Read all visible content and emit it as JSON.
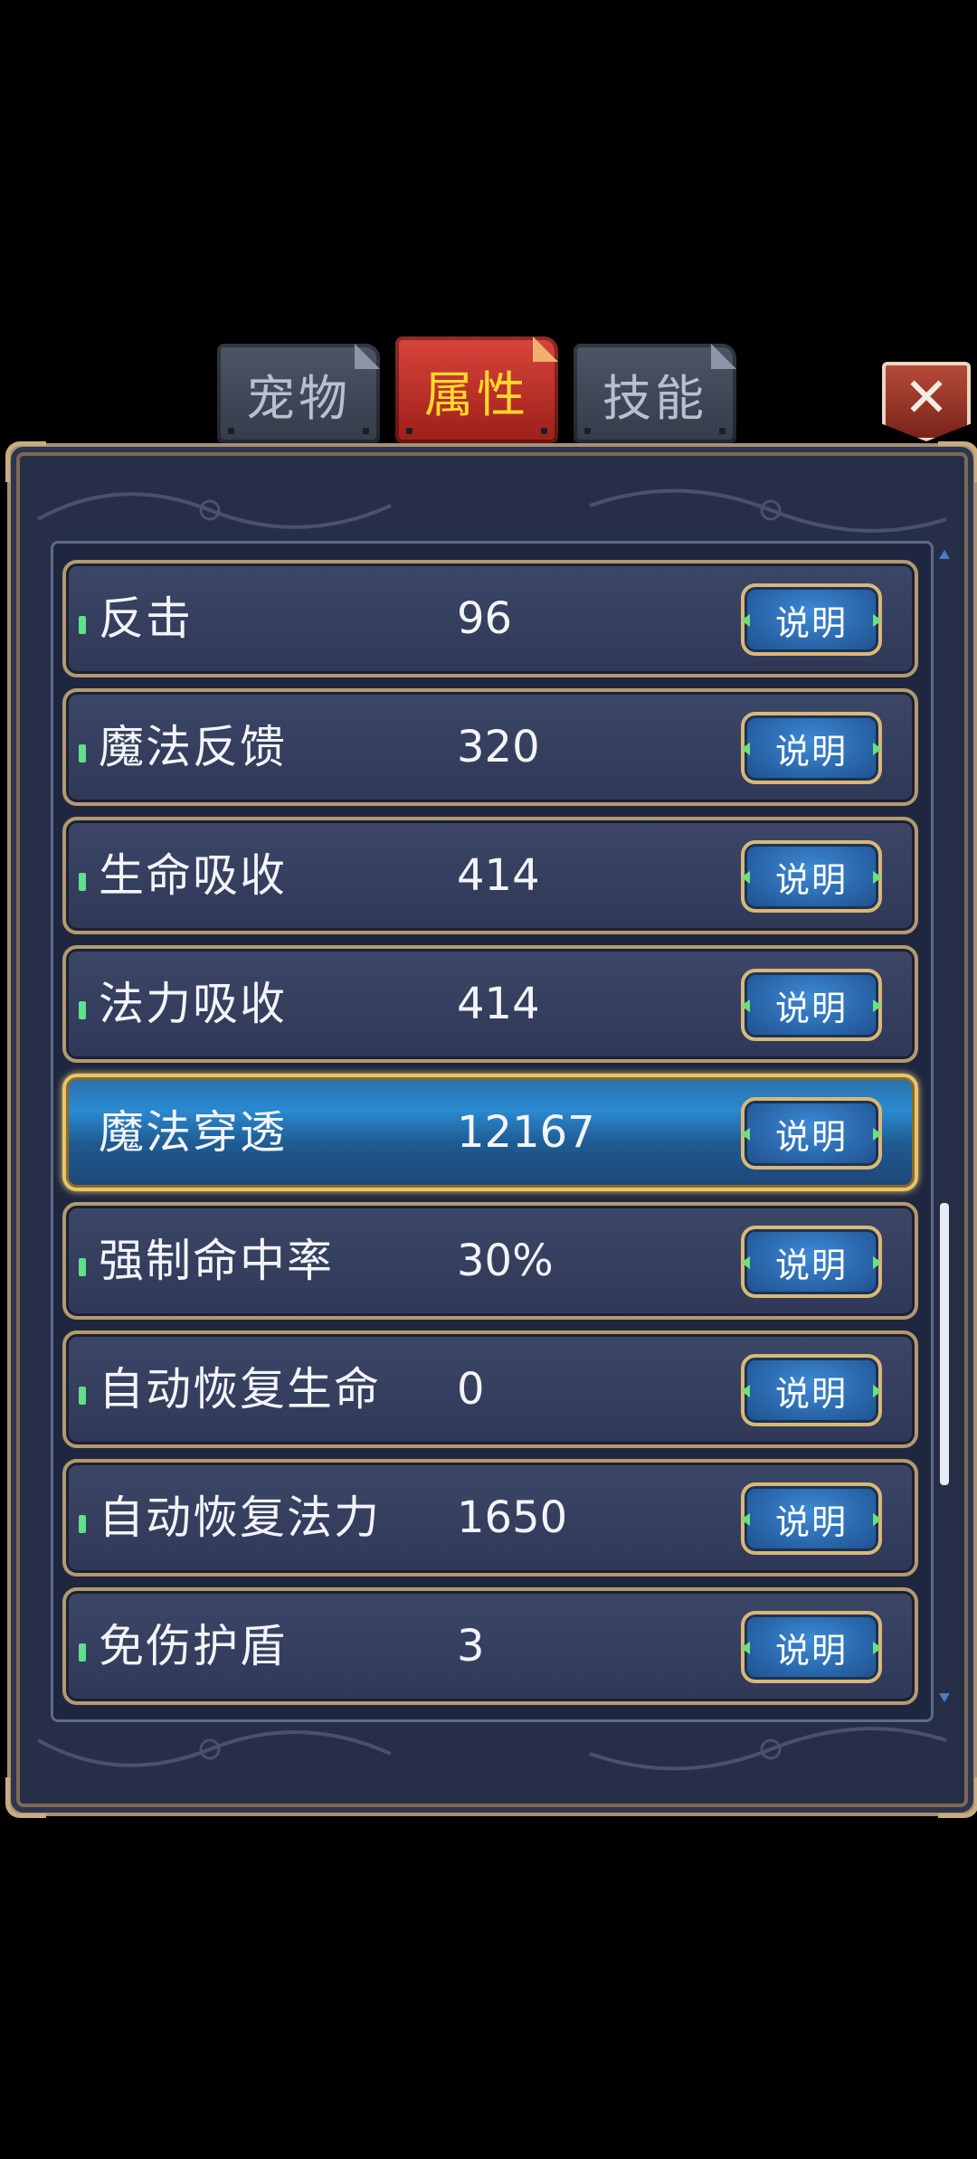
{
  "tabs": [
    {
      "label": "宠物",
      "active": false
    },
    {
      "label": "属性",
      "active": true
    },
    {
      "label": "技能",
      "active": false
    }
  ],
  "close": {
    "label": "✕"
  },
  "attributes": [
    {
      "name": "反击",
      "value": "96",
      "button": "说明"
    },
    {
      "name": "魔法反馈",
      "value": "320",
      "button": "说明"
    },
    {
      "name": "生命吸收",
      "value": "414",
      "button": "说明"
    },
    {
      "name": "法力吸收",
      "value": "414",
      "button": "说明"
    },
    {
      "name": "魔法穿透",
      "value": "12167",
      "button": "说明",
      "selected": true
    },
    {
      "name": "强制命中率",
      "value": "30%",
      "button": "说明"
    },
    {
      "name": "自动恢复生命",
      "value": "0",
      "button": "说明"
    },
    {
      "name": "自动恢复法力",
      "value": "1650",
      "button": "说明"
    },
    {
      "name": "免伤护盾",
      "value": "3",
      "button": "说明"
    }
  ],
  "colors": {
    "active_tab": "#c5362d",
    "active_tab_text": "#ffd92e",
    "selected_row": "#2a7fc4",
    "frame_gold": "#b39a6d"
  }
}
